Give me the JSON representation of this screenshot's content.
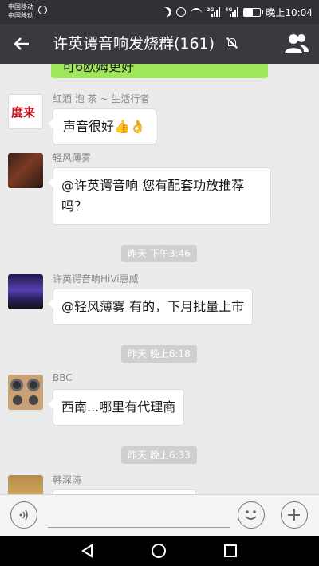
{
  "status_bar": {
    "carriers": [
      "中国移动",
      "中国移动"
    ],
    "signal_labels": [
      "2G",
      "4G"
    ],
    "time": "晚上10:04",
    "battery_level": 0.55
  },
  "header": {
    "title": "许英谔音响发烧群(161)",
    "back_icon": "back-arrow-icon",
    "mute_icon": "muted-bell-icon",
    "members_icon": "group-members-icon"
  },
  "chat": {
    "my_partial_bubble": "可6欧姆更好",
    "messages": [
      {
        "sender": "红酒 泡 茶 ~ 生活行者",
        "text": "声音很好👍👌",
        "avatar_text": "度来"
      },
      {
        "sender": "轻风薄雾",
        "text_lines": [
          "@许英谔音响 您有配套功放推荐",
          "吗？"
        ]
      },
      {
        "sender": "许英谔音响HiVi惠威",
        "text": "@轻风薄雾 有的，下月批量上市"
      },
      {
        "sender": "BBC",
        "text": "西南...哪里有代理商"
      },
      {
        "sender": "韩深涛"
      }
    ],
    "timestamps": [
      "昨天 下午3:46",
      "昨天 晚上6:18",
      "昨天 晚上6:33"
    ]
  },
  "input_bar": {
    "voice_icon": "voice-icon",
    "emoji_icon": "emoji-icon",
    "plus_icon": "plus-icon"
  },
  "nav_bar": {
    "back_icon": "nav-back-icon",
    "home_icon": "nav-home-icon",
    "recent_icon": "nav-recent-icon"
  },
  "colors": {
    "title_bar": "#393a3f",
    "status_bar": "#2f3134",
    "chat_bg": "#ebebeb",
    "my_bubble": "#9fe65a"
  }
}
